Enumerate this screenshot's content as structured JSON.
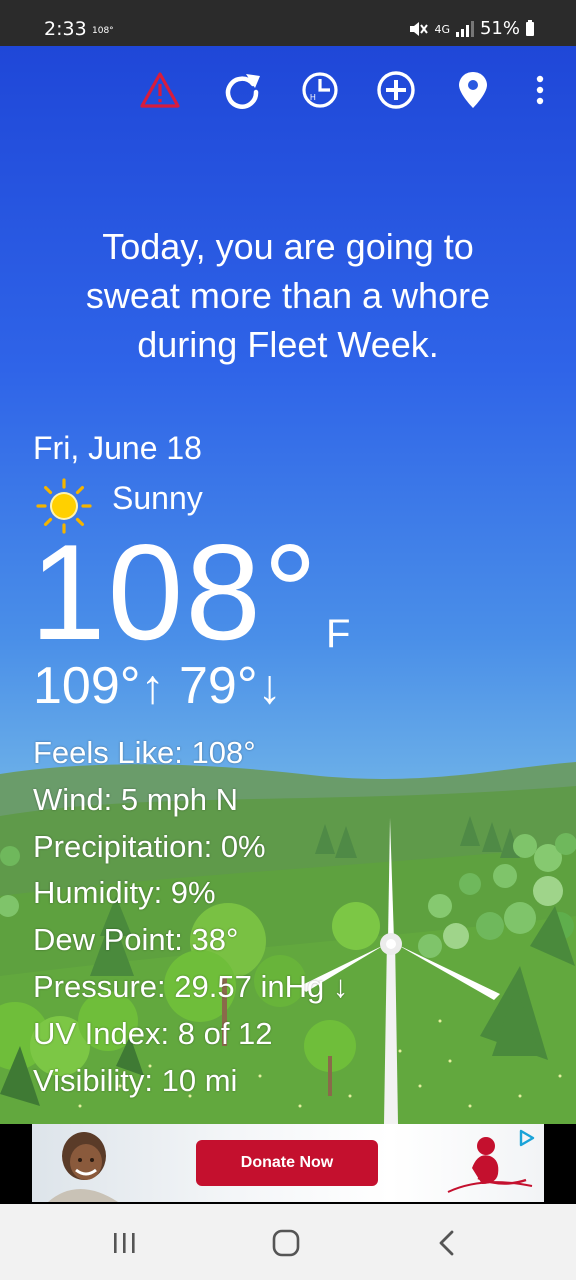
{
  "status_bar": {
    "time": "2:33",
    "temp_small": "108°",
    "network": "4G",
    "battery": "51%"
  },
  "toolbar": {
    "icons": [
      "warning-icon",
      "refresh-icon",
      "hourly-clock-icon",
      "add-location-icon",
      "location-pin-icon",
      "more-menu-icon"
    ]
  },
  "joke": {
    "line1": "Today, you are going to",
    "line2": "sweat more than a whore",
    "line3": "during Fleet Week."
  },
  "current": {
    "date": "Fri, June 18",
    "condition": "Sunny",
    "temperature": "108°",
    "unit": "F",
    "high": "109°",
    "low": "79°",
    "up_arrow": "↑",
    "down_arrow": "↓"
  },
  "details": {
    "feels_like": "Feels Like: 108°",
    "wind": "Wind: 5 mph N",
    "precipitation": "Precipitation: 0%",
    "humidity": "Humidity: 9%",
    "dew_point": "Dew Point: 38°",
    "pressure": "Pressure: 29.57 inHg ↓",
    "uv_index": "UV Index: 8 of 12",
    "visibility": "Visibility: 10 mi"
  },
  "ad": {
    "button_label": "Donate Now"
  },
  "nav": {
    "buttons": [
      "recents-button",
      "home-button",
      "back-button"
    ]
  },
  "colors": {
    "sky_top": "#1f47d8",
    "sky_bottom": "#88c2ea",
    "grass": "#5c9a3c",
    "warning": "#d81c3c",
    "donate": "#c4102e"
  }
}
